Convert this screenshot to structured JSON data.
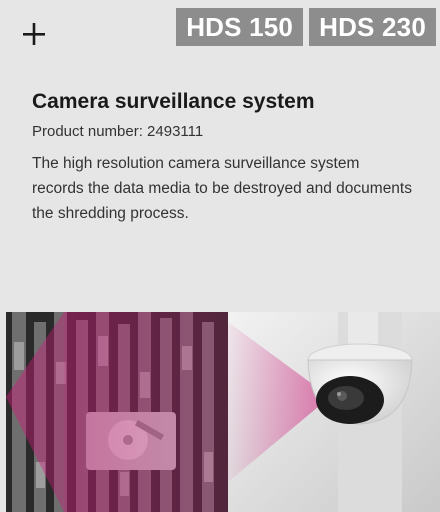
{
  "header": {
    "expand_icon": "plus-icon",
    "badges": [
      "HDS 150",
      "HDS 230"
    ]
  },
  "product": {
    "title": "Camera surveillance system",
    "number_text": "Product number: 2493111",
    "description": "The high resolution camera surveillance system records the data media to be destroyed and documents the shredding process."
  },
  "images": {
    "left": "shredder-interior-photo",
    "right": "dome-camera-photo"
  },
  "colors": {
    "background": "#e6e6e6",
    "badge": "#8d8d8d",
    "accent": "#d0197a",
    "text": "#333333"
  }
}
